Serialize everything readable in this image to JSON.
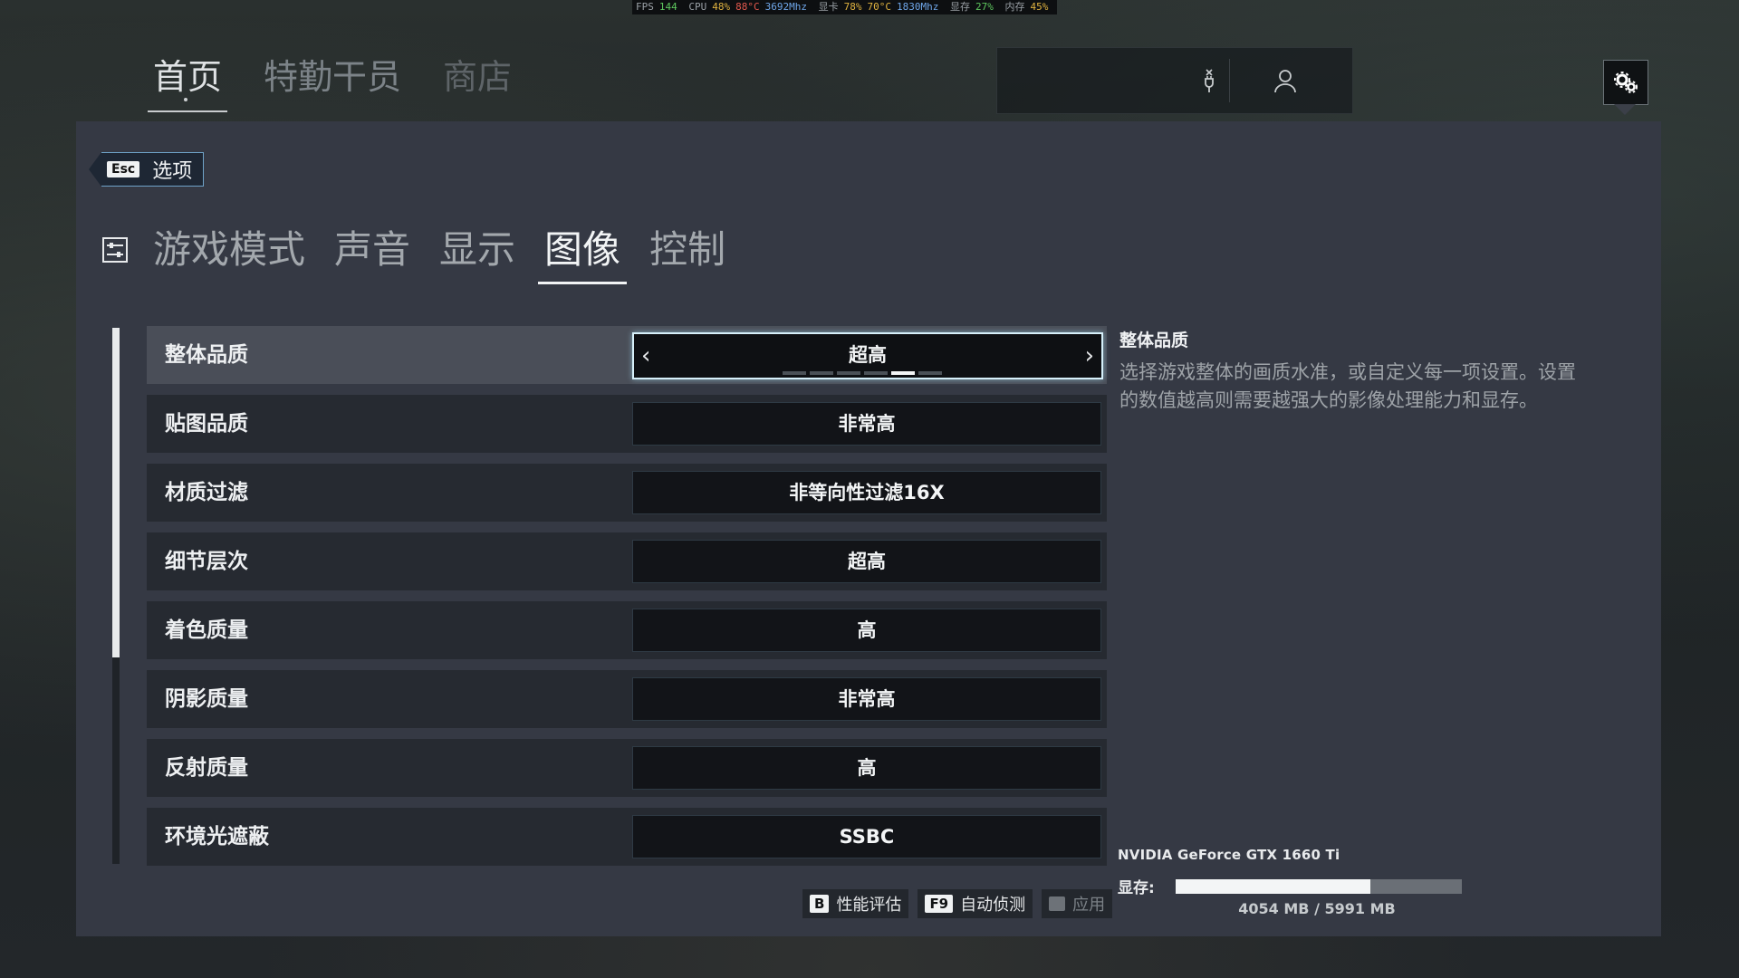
{
  "perf": {
    "fps_label": "FPS",
    "fps": "144",
    "cpu_label": "CPU",
    "cpu_usage": "48%",
    "cpu_temp": "88°C",
    "cpu_clock": "3692Mhz",
    "gpu_label": "显卡",
    "gpu_usage": "78%",
    "gpu_temp": "70°C",
    "gpu_clock": "1830Mhz",
    "vram_label": "显存",
    "vram_usage": "27%",
    "ram_label": "内存",
    "ram_usage": "45%"
  },
  "topnav": {
    "items": [
      "首页",
      "特勤干员",
      "商店"
    ],
    "active": 0
  },
  "toolbox": {
    "left_icon": "plug-icon",
    "right_icon": "user-icon"
  },
  "back": {
    "key": "Esc",
    "label": "选项"
  },
  "subnav": {
    "tabs": [
      "游戏模式",
      "声音",
      "显示",
      "图像",
      "控制"
    ],
    "active": 3
  },
  "settings": [
    {
      "label": "整体品质",
      "value": "超高"
    },
    {
      "label": "贴图品质",
      "value": "非常高"
    },
    {
      "label": "材质过滤",
      "value": "非等向性过滤16X"
    },
    {
      "label": "细节层次",
      "value": "超高"
    },
    {
      "label": "着色质量",
      "value": "高"
    },
    {
      "label": "阴影质量",
      "value": "非常高"
    },
    {
      "label": "反射质量",
      "value": "高"
    },
    {
      "label": "环境光遮蔽",
      "value": "SSBC"
    }
  ],
  "selected_pips": {
    "count": 6,
    "active_index": 4
  },
  "info": {
    "title": "整体品质",
    "description": "选择游戏整体的画质水准，或自定义每一项设置。设置的数值越高则需要越强大的影像处理能力和显存。"
  },
  "gpu": {
    "name": "NVIDIA GeForce GTX 1660 Ti",
    "vram_label": "显存:",
    "vram_used_fraction": 0.68,
    "vram_text": "4054 MB / 5991 MB"
  },
  "actions": [
    {
      "key": "B",
      "label": "性能评估",
      "enabled": true
    },
    {
      "key": "F9",
      "label": "自动侦测",
      "enabled": true
    },
    {
      "key": "",
      "label": "应用",
      "enabled": false
    }
  ],
  "colors": {
    "panel": "#353944",
    "row": "#262a31",
    "row_selected": "#4a4e58",
    "highlight": "#d6f0fa"
  }
}
